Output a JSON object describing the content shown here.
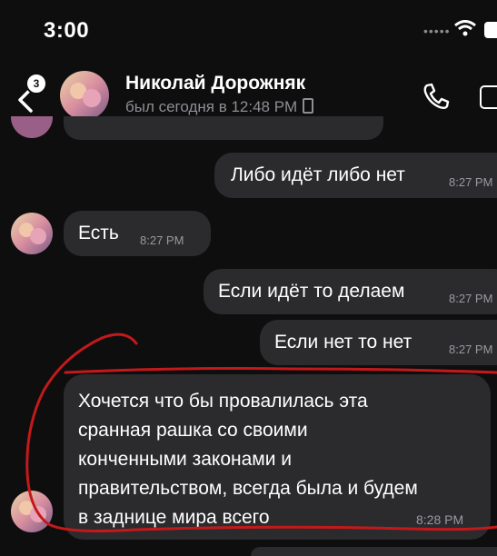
{
  "status_bar": {
    "time": "3:00",
    "signal": "•••••"
  },
  "header": {
    "unread_count": "3",
    "contact_name": "Николай Дорожняк",
    "last_seen": "был сегодня в 12:48 PM"
  },
  "messages": [
    {
      "direction": "out",
      "text": "Либо идёт либо нет",
      "time": "8:27 PM"
    },
    {
      "direction": "in",
      "text": "Есть",
      "time": "8:27 PM"
    },
    {
      "direction": "out",
      "text": "Если идёт то делаем",
      "time": "8:27 PM"
    },
    {
      "direction": "out",
      "text": "Если нет то нет",
      "time": "8:27 PM"
    },
    {
      "direction": "in",
      "lines": [
        "Хочется что бы провалилась эта",
        "сранная рашка со своими",
        "конченными законами и",
        "правительством, всегда была и будем",
        "в заднице мира всего"
      ],
      "time": "8:28 PM"
    }
  ],
  "colors": {
    "background": "#0e0e0f",
    "bubble": "#2b2b2e",
    "annotation_stroke": "#c4191b",
    "secondary_text": "#8e8e93"
  },
  "icons": [
    "back-chevron-icon",
    "phone-icon",
    "video-call-icon",
    "wifi-icon",
    "battery-icon"
  ]
}
